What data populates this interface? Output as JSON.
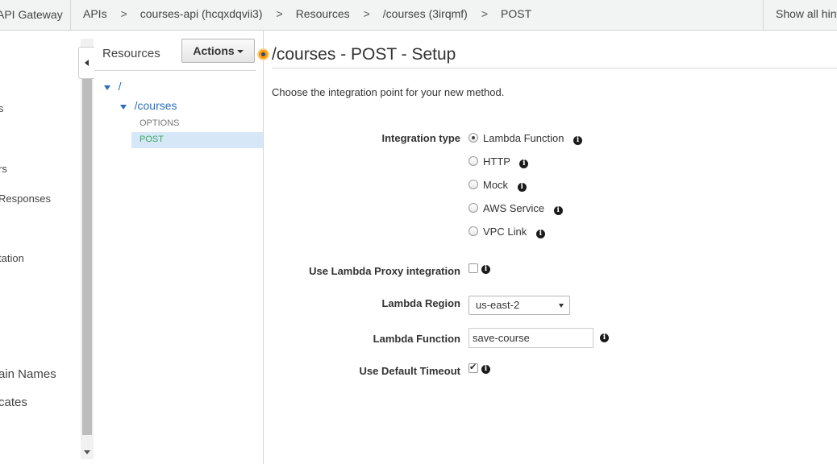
{
  "topbar": {
    "brand": "API Gateway",
    "breadcrumbs": [
      "APIs",
      "courses-api (hcqxdqvii3)",
      "Resources",
      "/courses (3irqmf)",
      "POST"
    ],
    "separator": ">",
    "hints": "Show all hints"
  },
  "leftnav": {
    "items": [
      "s",
      "rs",
      "Responses",
      "tation",
      "ain Names",
      "cates"
    ]
  },
  "resources": {
    "title": "Resources",
    "actions_label": "Actions",
    "tree": {
      "root": "/",
      "child": "/courses",
      "methods": [
        "OPTIONS",
        "POST"
      ],
      "selected_method": "POST"
    }
  },
  "main": {
    "title": "/courses - POST - Setup",
    "intro": "Choose the integration point for your new method.",
    "integration_type_label": "Integration type",
    "integration_options": [
      "Lambda Function",
      "HTTP",
      "Mock",
      "AWS Service",
      "VPC Link"
    ],
    "selected_integration": "Lambda Function",
    "proxy_label": "Use Lambda Proxy integration",
    "proxy_checked": false,
    "region_label": "Lambda Region",
    "region_value": "us-east-2",
    "function_label": "Lambda Function",
    "function_value": "save-course",
    "timeout_label": "Use Default Timeout",
    "timeout_checked": true
  },
  "colors": {
    "link_blue": "#2a6ebb",
    "method_green": "#3aa55d",
    "selected_bg": "#d6e8f7",
    "accent_orange": "#ff9900"
  }
}
